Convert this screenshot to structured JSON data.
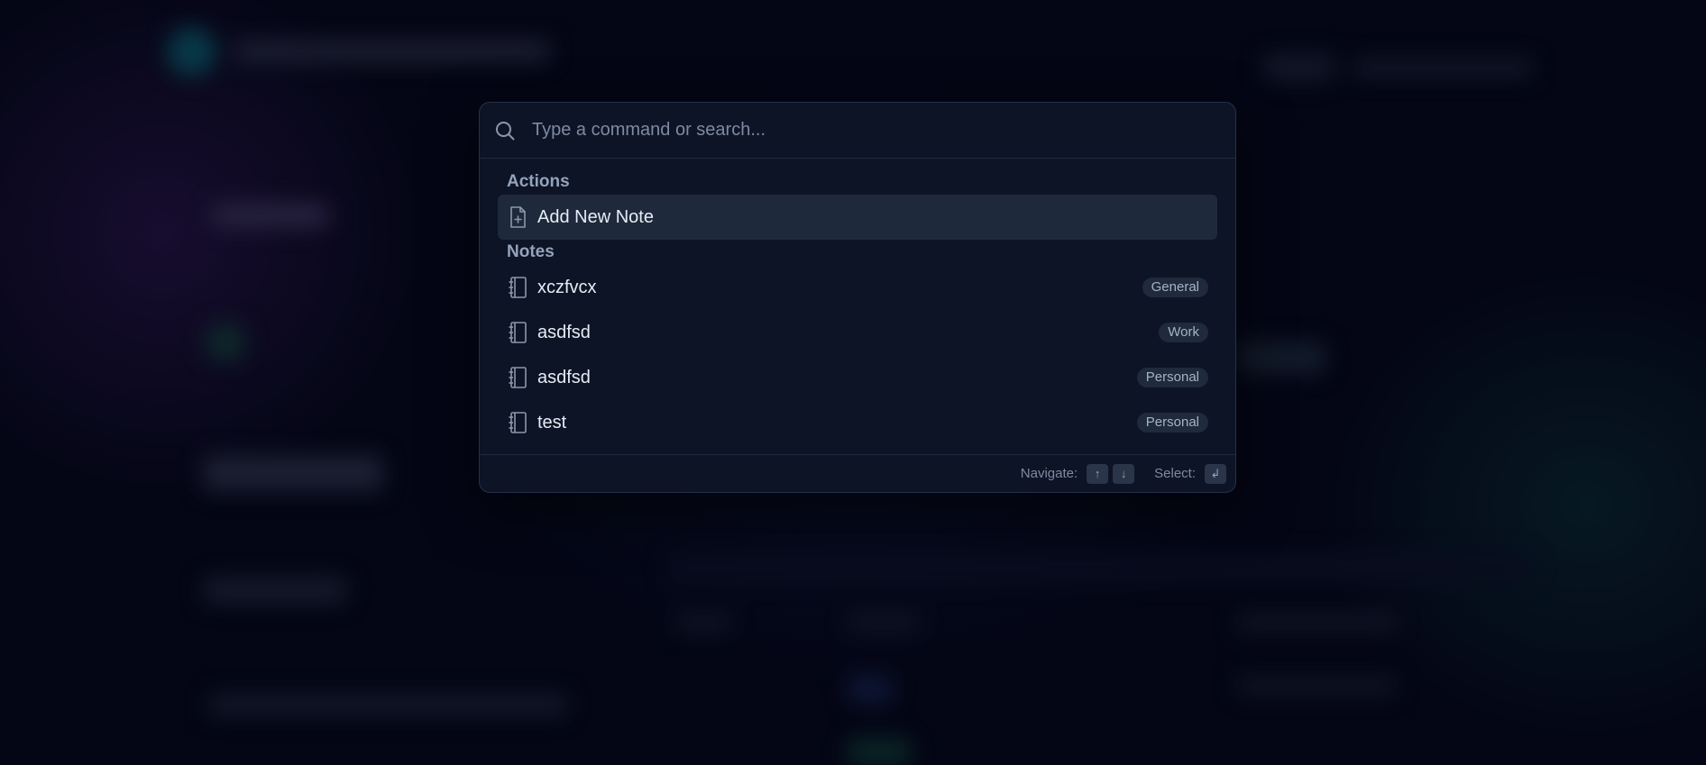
{
  "search": {
    "placeholder": "Type a command or search...",
    "value": ""
  },
  "groups": [
    {
      "label": "Actions",
      "items": [
        {
          "label": "Add New Note",
          "icon": "file-plus-icon",
          "badge": "",
          "selected": true
        }
      ]
    },
    {
      "label": "Notes",
      "items": [
        {
          "label": "xczfvcx",
          "icon": "notebook-icon",
          "badge": "General"
        },
        {
          "label": "asdfsd",
          "icon": "notebook-icon",
          "badge": "Work"
        },
        {
          "label": "asdfsd",
          "icon": "notebook-icon",
          "badge": "Personal"
        },
        {
          "label": "test",
          "icon": "notebook-icon",
          "badge": "Personal"
        }
      ]
    }
  ],
  "footer": {
    "navigate_label": "Navigate:",
    "navigate_keys": [
      "↑",
      "↓"
    ],
    "select_label": "Select:",
    "select_key": "↲"
  },
  "colors": {
    "palette_bg": "#0d1425",
    "selected_bg": "#1e293b",
    "badge_bg": "#1f2a3c",
    "page_bg": "#050819"
  }
}
